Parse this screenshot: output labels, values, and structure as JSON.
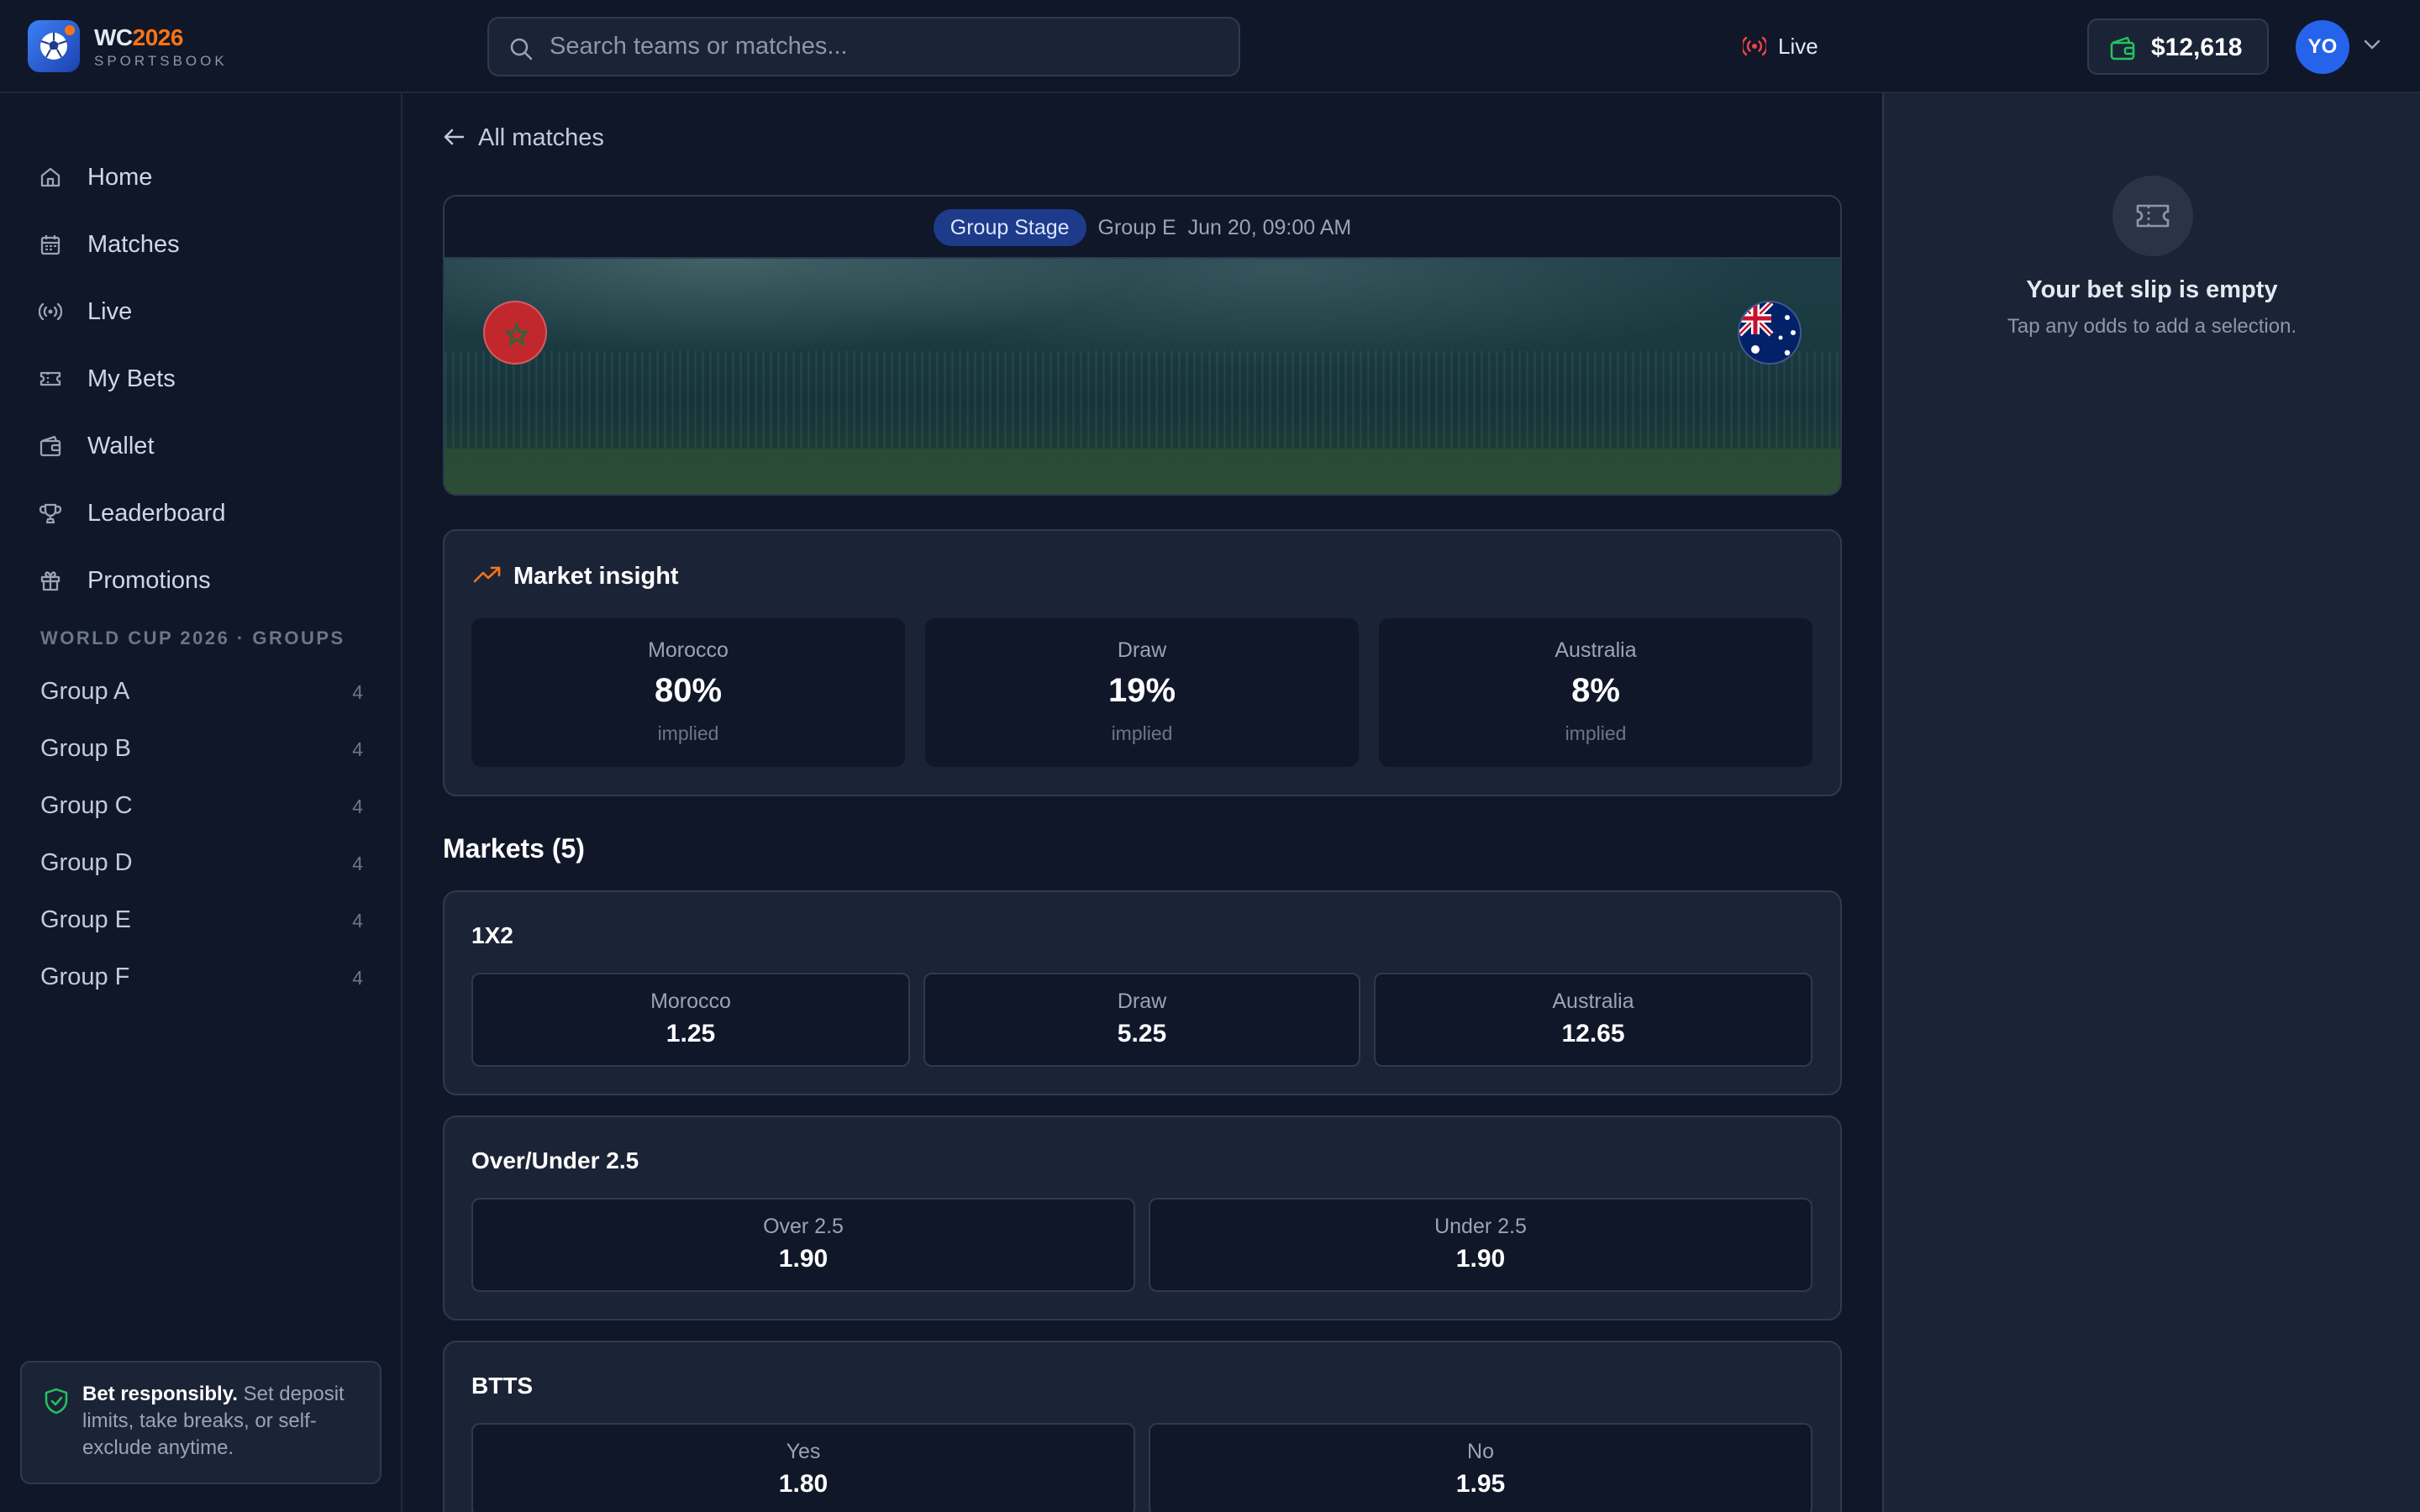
{
  "brand": {
    "title_prefix": "WC",
    "title_year": "2026",
    "subtitle": "SPORTSBOOK"
  },
  "search": {
    "placeholder": "Search teams or matches..."
  },
  "header": {
    "live_label": "Live",
    "balance": "$12,618",
    "avatar_initials": "YO"
  },
  "sidebar": {
    "nav": [
      {
        "label": "Home",
        "icon": "home-icon"
      },
      {
        "label": "Matches",
        "icon": "calendar-icon"
      },
      {
        "label": "Live",
        "icon": "broadcast-icon"
      },
      {
        "label": "My Bets",
        "icon": "ticket-icon"
      },
      {
        "label": "Wallet",
        "icon": "wallet-icon"
      },
      {
        "label": "Leaderboard",
        "icon": "trophy-icon"
      },
      {
        "label": "Promotions",
        "icon": "gift-icon"
      }
    ],
    "groups_title": "WORLD CUP 2026 · GROUPS",
    "groups": [
      {
        "name": "Group A",
        "count": "4"
      },
      {
        "name": "Group B",
        "count": "4"
      },
      {
        "name": "Group C",
        "count": "4"
      },
      {
        "name": "Group D",
        "count": "4"
      },
      {
        "name": "Group E",
        "count": "4"
      },
      {
        "name": "Group F",
        "count": "4"
      }
    ],
    "responsible": {
      "bold": "Bet responsibly.",
      "text": " Set deposit limits, take breaks, or self-exclude anytime."
    }
  },
  "main": {
    "back_label": "All matches",
    "match": {
      "stage": "Group Stage",
      "group": "Group E",
      "datetime": "Jun 20, 09:00 AM",
      "home_team": "Morocco",
      "away_team": "Australia"
    },
    "insight": {
      "title": "Market insight",
      "cards": [
        {
          "name": "Morocco",
          "value": "80%",
          "label": "implied"
        },
        {
          "name": "Draw",
          "value": "19%",
          "label": "implied"
        },
        {
          "name": "Australia",
          "value": "8%",
          "label": "implied"
        }
      ]
    },
    "markets_title": "Markets (5)",
    "markets": [
      {
        "title": "1X2",
        "options": [
          {
            "name": "Morocco",
            "odds": "1.25"
          },
          {
            "name": "Draw",
            "odds": "5.25"
          },
          {
            "name": "Australia",
            "odds": "12.65"
          }
        ]
      },
      {
        "title": "Over/Under 2.5",
        "options": [
          {
            "name": "Over 2.5",
            "odds": "1.90"
          },
          {
            "name": "Under 2.5",
            "odds": "1.90"
          }
        ]
      },
      {
        "title": "BTTS",
        "options": [
          {
            "name": "Yes",
            "odds": "1.80"
          },
          {
            "name": "No",
            "odds": "1.95"
          }
        ]
      }
    ]
  },
  "betslip": {
    "title": "Your bet slip is empty",
    "subtitle": "Tap any odds to add a selection."
  },
  "colors": {
    "accent": "#f97316",
    "primary": "#2563eb",
    "live": "#ef4444",
    "success": "#22c55e",
    "background": "#0f1729",
    "panel": "#1b2436"
  }
}
